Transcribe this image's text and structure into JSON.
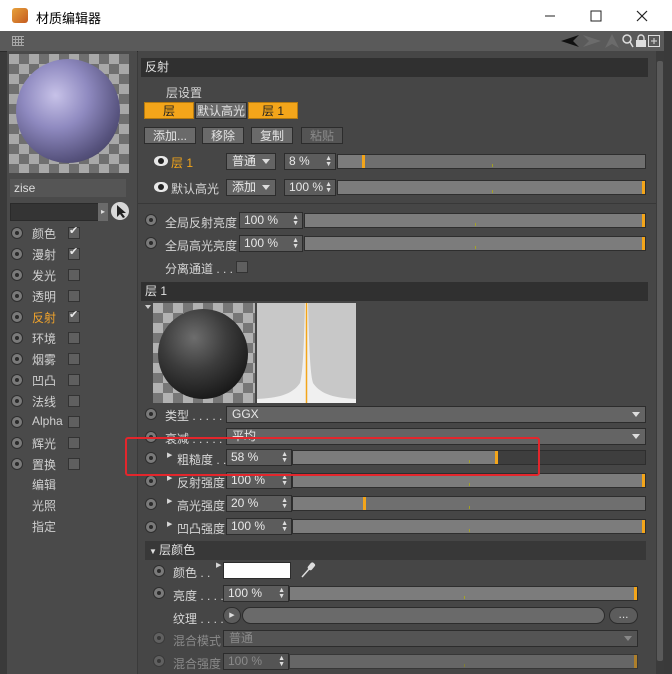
{
  "window": {
    "title": "材质编辑器",
    "controls": [
      "minimize",
      "maximize",
      "close"
    ]
  },
  "toolbar": {
    "icons": [
      "back-arrow-icon",
      "forward-arrow-icon",
      "up-arrow-icon",
      "search-icon",
      "lock-icon",
      "add-window-icon"
    ]
  },
  "material": {
    "name": "zise",
    "preview_color": "#8f8ac0",
    "channels": [
      {
        "label": "颜色",
        "checked": true,
        "active": false
      },
      {
        "label": "漫射",
        "checked": true,
        "active": false
      },
      {
        "label": "发光",
        "checked": false,
        "active": false
      },
      {
        "label": "透明",
        "checked": false,
        "active": false
      },
      {
        "label": "反射",
        "checked": true,
        "active": true
      },
      {
        "label": "环境",
        "checked": false,
        "active": false
      },
      {
        "label": "烟雾",
        "checked": false,
        "active": false
      },
      {
        "label": "凹凸",
        "checked": false,
        "active": false
      },
      {
        "label": "法线",
        "checked": false,
        "active": false
      },
      {
        "label": "Alpha",
        "checked": false,
        "active": false
      },
      {
        "label": "辉光",
        "checked": false,
        "active": false
      },
      {
        "label": "置换",
        "checked": false,
        "active": false
      }
    ],
    "extra_items": [
      "编辑",
      "光照",
      "指定"
    ]
  },
  "reflect": {
    "title": "反射",
    "layer_settings": "层设置",
    "tabs": [
      "层",
      "默认高光",
      "层 1"
    ],
    "buttons": {
      "add": "添加...",
      "remove": "移除",
      "copy": "复制",
      "paste": "粘贴"
    },
    "layers": [
      {
        "name": "层 1",
        "mode": "普通",
        "value": "8 %",
        "fraction": 0.08,
        "highlight": true
      },
      {
        "name": "默认高光",
        "mode": "添加",
        "value": "100 %",
        "fraction": 1.0,
        "highlight": false
      }
    ],
    "global_reflection": {
      "label": "全局反射亮度",
      "value": "100 %",
      "fraction": 1.0
    },
    "global_specular": {
      "label": "全局高光亮度",
      "value": "100 %",
      "fraction": 1.0
    },
    "separate_pass": {
      "label": "分离通道 . . .",
      "checked": false
    }
  },
  "layer1": {
    "title": "层 1",
    "type": {
      "label": "类型 . . . . . .",
      "value": "GGX"
    },
    "attenuation": {
      "label": "衰减 . . . . . .",
      "value": "平均"
    },
    "roughness": {
      "label": "粗糙度 . .",
      "value": "58 %",
      "fraction": 0.58
    },
    "reflection_strength": {
      "label": "反射强度",
      "value": "100 %",
      "fraction": 1.0
    },
    "specular_strength": {
      "label": "高光强度",
      "value": "20 %",
      "fraction": 0.2
    },
    "bump_strength": {
      "label": "凹凸强度",
      "value": "100 %",
      "fraction": 1.0
    }
  },
  "layer_color": {
    "title": "层颜色",
    "color": {
      "label": "颜色 . .",
      "value": "#ffffff"
    },
    "brightness": {
      "label": "亮度 . . . .",
      "value": "100 %",
      "fraction": 1.0
    },
    "texture": {
      "label": "纹理 . . . .",
      "browse": "..."
    },
    "blend_mode": {
      "label": "混合模式",
      "value": "普通"
    },
    "blend_strength": {
      "label": "混合强度",
      "value": "100 %",
      "fraction": 1.0
    }
  },
  "accent": "#f3a51a",
  "annotation_color": "#e3262c"
}
